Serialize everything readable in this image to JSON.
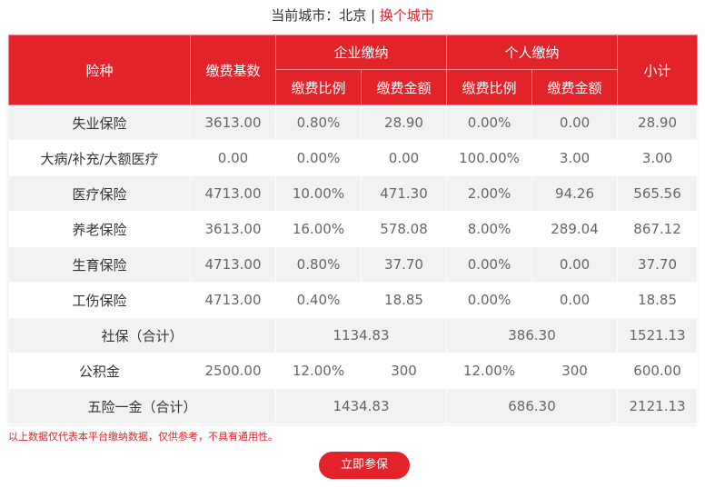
{
  "city": {
    "prefix": "当前城市：北京 | ",
    "change_link": "换个城市"
  },
  "table": {
    "headers": {
      "type": "险种",
      "base": "缴费基数",
      "company_group": "企业缴纳",
      "personal_group": "个人缴纳",
      "company_rate": "缴费比例",
      "company_amount": "缴费金额",
      "personal_rate": "缴费比例",
      "personal_amount": "缴费金额",
      "subtotal": "小计"
    },
    "rows": [
      {
        "name": "失业保险",
        "base": "3613.00",
        "c_rate": "0.80%",
        "c_amt": "28.90",
        "p_rate": "0.00%",
        "p_amt": "0.00",
        "sub": "28.90"
      },
      {
        "name": "大病/补充/大额医疗",
        "base": "0.00",
        "c_rate": "0.00%",
        "c_amt": "0.00",
        "p_rate": "100.00%",
        "p_amt": "3.00",
        "sub": "3.00"
      },
      {
        "name": "医疗保险",
        "base": "4713.00",
        "c_rate": "10.00%",
        "c_amt": "471.30",
        "p_rate": "2.00%",
        "p_amt": "94.26",
        "sub": "565.56"
      },
      {
        "name": "养老保险",
        "base": "3613.00",
        "c_rate": "16.00%",
        "c_amt": "578.08",
        "p_rate": "8.00%",
        "p_amt": "289.04",
        "sub": "867.12"
      },
      {
        "name": "生育保险",
        "base": "4713.00",
        "c_rate": "0.80%",
        "c_amt": "37.70",
        "p_rate": "0.00%",
        "p_amt": "0.00",
        "sub": "37.70"
      },
      {
        "name": "工伤保险",
        "base": "4713.00",
        "c_rate": "0.40%",
        "c_amt": "18.85",
        "p_rate": "0.00%",
        "p_amt": "0.00",
        "sub": "18.85"
      }
    ],
    "social_total": {
      "name": "社保（合计）",
      "company": "1134.83",
      "personal": "386.30",
      "sub": "1521.13"
    },
    "fund": {
      "name": "公积金",
      "base": "2500.00",
      "c_rate": "12.00%",
      "c_amt": "300",
      "p_rate": "12.00%",
      "p_amt": "300",
      "sub": "600.00"
    },
    "grand_total": {
      "name": "五险一金（合计）",
      "company": "1434.83",
      "personal": "686.30",
      "sub": "2121.13"
    }
  },
  "note": "以上数据仅代表本平台缴纳数据，仅供参考，不具有通用性。",
  "join_button": "立即参保",
  "colors": {
    "accent": "#e2232a",
    "stripe": "#f2f2f2"
  }
}
